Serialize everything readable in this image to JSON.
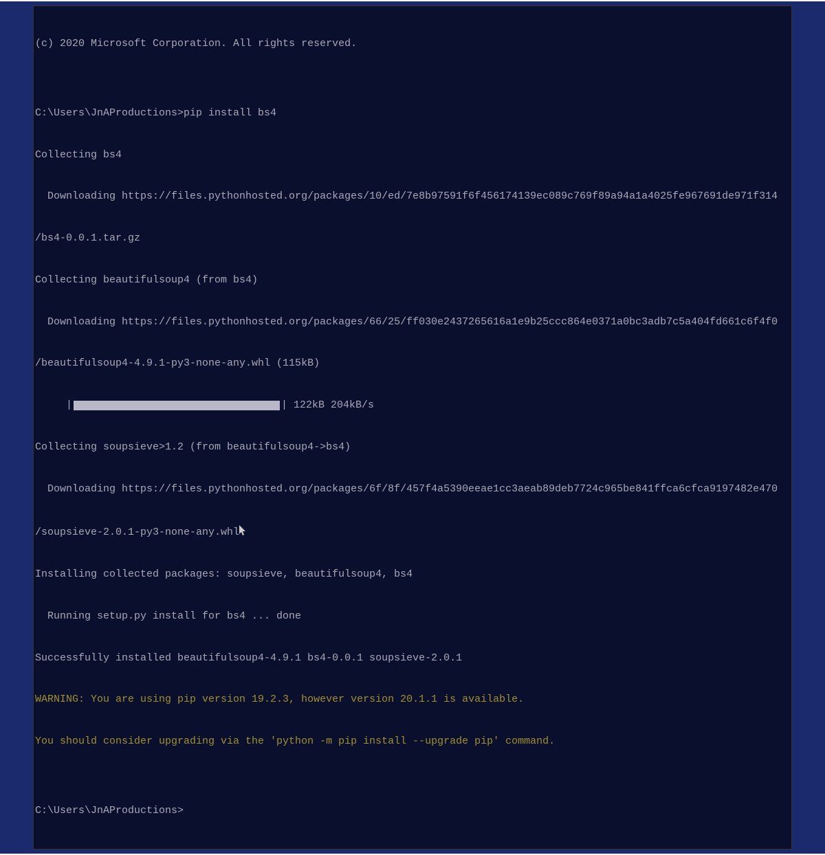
{
  "terminal": {
    "copyright": "(c) 2020 Microsoft Corporation. All rights reserved.",
    "blank1": "",
    "prompt1": "C:\\Users\\JnAProductions>pip install bs4",
    "collecting1": "Collecting bs4",
    "download1": "  Downloading https://files.pythonhosted.org/packages/10/ed/7e8b97591f6f456174139ec089c769f89a94a1a4025fe967691de971f314",
    "download1b": "/bs4-0.0.1.tar.gz",
    "collecting2": "Collecting beautifulsoup4 (from bs4)",
    "download2": "  Downloading https://files.pythonhosted.org/packages/66/25/ff030e2437265616a1e9b25ccc864e0371a0bc3adb7c5a404fd661c6f4f0",
    "download2b": "/beautifulsoup4-4.9.1-py3-none-any.whl (115kB)",
    "progress_prefix": "     |",
    "progress_suffix": "| 122kB 204kB/s",
    "collecting3": "Collecting soupsieve>1.2 (from beautifulsoup4->bs4)",
    "download3": "  Downloading https://files.pythonhosted.org/packages/6f/8f/457f4a5390eeae1cc3aeab89deb7724c965be841ffca6cfca9197482e470",
    "download3b": "/soupsieve-2.0.1-py3-none-any.whl",
    "installing": "Installing collected packages: soupsieve, beautifulsoup4, bs4",
    "running": "  Running setup.py install for bs4 ... done",
    "success": "Successfully installed beautifulsoup4-4.9.1 bs4-0.0.1 soupsieve-2.0.1",
    "warning1": "WARNING: You are using pip version 19.2.3, however version 20.1.1 is available.",
    "warning2": "You should consider upgrading via the 'python -m pip install --upgrade pip' command.",
    "blank2": "",
    "prompt2": "C:\\Users\\JnAProductions>"
  }
}
